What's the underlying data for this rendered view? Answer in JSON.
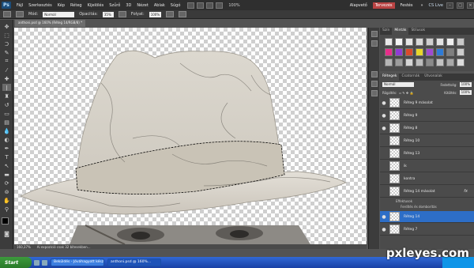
{
  "menu": {
    "logo": "Ps",
    "items": [
      "Fájl",
      "Szerkesztés",
      "Kép",
      "Réteg",
      "Kijelölés",
      "Szűrő",
      "3D",
      "Nézet",
      "Ablak",
      "Súgó"
    ],
    "zoom": "100%",
    "workspaces": [
      "Alapvető",
      "Tervezés",
      "Festés"
    ],
    "active_workspace": "Tervezés",
    "cs_live": "CS Live"
  },
  "options": {
    "mode_label": "Mód:",
    "mode_value": "Normál",
    "opacity_label": "Opacitás:",
    "opacity_value": "35%",
    "flow_label": "Folyat:",
    "flow_value": "100%"
  },
  "document": {
    "tab_title": "anthoni.psd @ 160% (Réteg 14/RGB/8) *",
    "status_zoom": "160,37%",
    "status_info": "Ai expozíció csak 32 bitesekben..."
  },
  "swatches_panel": {
    "tabs": [
      "Szín",
      "Minták",
      "Stílusok"
    ],
    "active_tab": "Minták",
    "colors": [
      "#e9e9e9",
      "#f4f4f4",
      "#e6e6e6",
      "#d9d9d9",
      "#cfcfcf",
      "#e2e2e2",
      "#eeeeee",
      "#c8c8c8",
      "#e62e8a",
      "#8f3bd6",
      "#d94a2b",
      "#e8d72a",
      "#a04ad0",
      "#2e7bd6",
      "#7f7f7f",
      "#cccccc",
      "#b5b5b5",
      "#9c9c9c",
      "#d5d5d5",
      "#bdbdbd",
      "#8a8a8a",
      "#c2c2c2",
      "#a9a9a9",
      "#dcdcdc"
    ]
  },
  "layers_panel": {
    "tabs": [
      "Rétegek",
      "Csatornák",
      "Útvonalak"
    ],
    "active_tab": "Rétegek",
    "blend_mode": "Normál",
    "opacity_label": "Fedettség:",
    "opacity_value": "100%",
    "lock_label": "Rögzítés:",
    "fill_label": "Kitöltés:",
    "fill_value": "100%",
    "layers": [
      {
        "name": "Réteg 9 másolat",
        "visible": true,
        "fx": false,
        "selected": false
      },
      {
        "name": "Réteg 9",
        "visible": true,
        "fx": false,
        "selected": false
      },
      {
        "name": "Réteg 8",
        "visible": true,
        "fx": false,
        "selected": false
      },
      {
        "name": "Réteg 10",
        "visible": false,
        "fx": false,
        "selected": false
      },
      {
        "name": "Réteg 13",
        "visible": false,
        "fx": false,
        "selected": false
      },
      {
        "name": "ik",
        "visible": false,
        "fx": false,
        "selected": false
      },
      {
        "name": "kontra",
        "visible": false,
        "fx": false,
        "selected": false
      },
      {
        "name": "Réteg 14 másolat",
        "visible": false,
        "fx": true,
        "selected": false
      },
      {
        "name": "Réteg 14",
        "visible": true,
        "fx": false,
        "selected": true
      },
      {
        "name": "Réteg 7",
        "visible": true,
        "fx": false,
        "selected": false
      }
    ],
    "effects_label": "Effektusok",
    "effect_item": "Ferdítés és domborítás"
  },
  "taskbar": {
    "start": "Start",
    "tasks": [
      "Beküldés - Jóváhagyott kész",
      "anthoni.psd @ 160%..."
    ],
    "active_task": 1
  },
  "watermark": "pxleyes.com"
}
